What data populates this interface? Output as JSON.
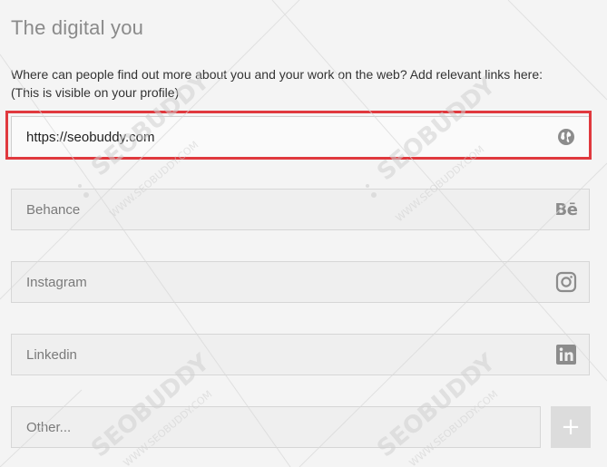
{
  "section": {
    "title": "The digital you",
    "description_line1": "Where can people find out more about you and your work on the web? Add relevant links here:",
    "description_line2": "(This is visible on your profile)"
  },
  "fields": {
    "website": {
      "value": "https://seobuddy.com",
      "icon": "globe-icon"
    },
    "behance": {
      "placeholder": "Behance",
      "icon_text": "Bē",
      "icon": "behance-icon"
    },
    "instagram": {
      "placeholder": "Instagram",
      "icon": "instagram-icon"
    },
    "linkedin": {
      "placeholder": "Linkedin",
      "icon_text": "in",
      "icon": "linkedin-icon"
    },
    "other": {
      "placeholder": "Other..."
    }
  },
  "add_button": {
    "label": "+",
    "icon": "plus-icon"
  },
  "watermark": {
    "brand": "SEOBUDDY",
    "url": "WWW.SEOBUDDY.COM"
  },
  "colors": {
    "highlight": "#e0393e",
    "icon": "#8c8c8c",
    "add_button_bg": "#dcdcdc"
  }
}
